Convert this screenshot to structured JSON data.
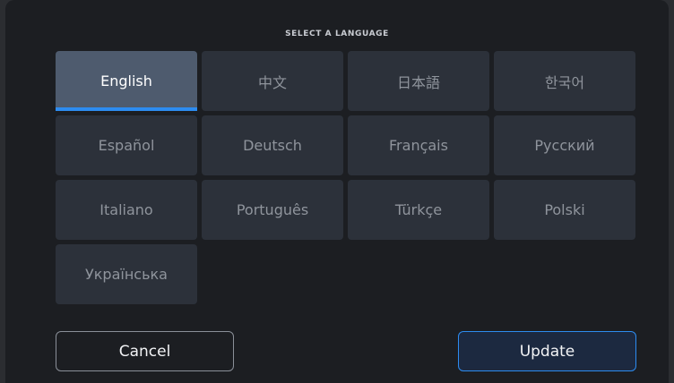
{
  "dialog": {
    "title": "SELECT A LANGUAGE"
  },
  "languages": [
    {
      "label": "English",
      "selected": true
    },
    {
      "label": "中文",
      "selected": false
    },
    {
      "label": "日本語",
      "selected": false
    },
    {
      "label": "한국어",
      "selected": false
    },
    {
      "label": "Español",
      "selected": false
    },
    {
      "label": "Deutsch",
      "selected": false
    },
    {
      "label": "Français",
      "selected": false
    },
    {
      "label": "Русский",
      "selected": false
    },
    {
      "label": "Italiano",
      "selected": false
    },
    {
      "label": "Português",
      "selected": false
    },
    {
      "label": "Türkçe",
      "selected": false
    },
    {
      "label": "Polski",
      "selected": false
    },
    {
      "label": "Українська",
      "selected": false
    }
  ],
  "buttons": {
    "cancel_label": "Cancel",
    "update_label": "Update"
  },
  "colors": {
    "accent": "#2d8cf0",
    "selected_tile": "#4e5b6e",
    "tile": "#2c313a",
    "background": "#1c1e22"
  }
}
